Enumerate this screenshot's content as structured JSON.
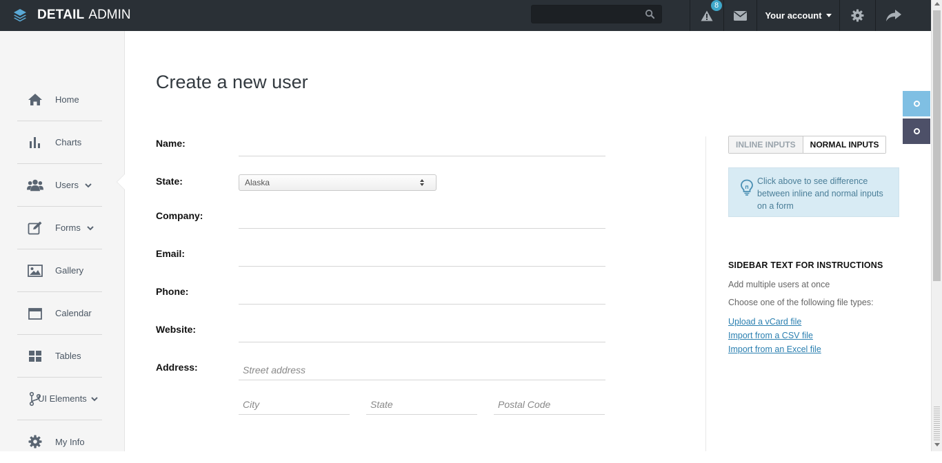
{
  "brand": {
    "bold": "DETAIL",
    "light": "ADMIN",
    "icon": "layers-icon"
  },
  "topbar": {
    "search": {
      "value": "",
      "placeholder": "",
      "icon": "search-icon"
    },
    "alerts": {
      "icon": "warning-icon",
      "count": "8"
    },
    "messages": {
      "icon": "envelope-icon"
    },
    "account_label": "Your account",
    "settings_icon": "gear-icon",
    "logout_icon": "share-arrow-icon"
  },
  "sidebar": {
    "items": [
      {
        "label": "Home",
        "icon": "home-icon"
      },
      {
        "label": "Charts",
        "icon": "bar-chart-icon"
      },
      {
        "label": "Users",
        "icon": "users-icon",
        "expandable": true
      },
      {
        "label": "Forms",
        "icon": "edit-icon",
        "expandable": true
      },
      {
        "label": "Gallery",
        "icon": "image-icon"
      },
      {
        "label": "Calendar",
        "icon": "calendar-icon"
      },
      {
        "label": "Tables",
        "icon": "grid-icon"
      },
      {
        "label": "UI Elements",
        "icon": "branch-icon",
        "expandable": true
      },
      {
        "label": "My Info",
        "icon": "gear-icon"
      }
    ],
    "active": "Users"
  },
  "main": {
    "title": "Create a new user",
    "form": {
      "name_label": "Name:",
      "name_value": "",
      "state_label": "State:",
      "state_value": "Alaska",
      "company_label": "Company:",
      "company_value": "",
      "email_label": "Email:",
      "email_value": "",
      "phone_label": "Phone:",
      "phone_value": "",
      "website_label": "Website:",
      "website_value": "",
      "address_label": "Address:",
      "street_placeholder": "Street address",
      "city_placeholder": "City",
      "state_placeholder": "State",
      "postal_placeholder": "Postal Code"
    }
  },
  "right": {
    "toggle_inline": "INLINE INPUTS",
    "toggle_normal": "NORMAL INPUTS",
    "info_text": "Click above to see difference between inline and normal inputs on a form",
    "info_icon": "lightbulb-icon",
    "heading": "SIDEBAR TEXT FOR INSTRUCTIONS",
    "text1": "Add multiple users at once",
    "text2": "Choose one of the following file types:",
    "links": [
      "Upload a vCard file",
      "Import from a CSV file",
      "Import from an Excel file"
    ]
  },
  "colors": {
    "topbar": "#2a3036",
    "sidebar": "#f5f5f5",
    "badge": "#3fa7c9",
    "float_light": "#7fbfe3",
    "float_dark": "#4d5068",
    "info_bg": "#d8ebf4",
    "link": "#2a7fb0"
  }
}
